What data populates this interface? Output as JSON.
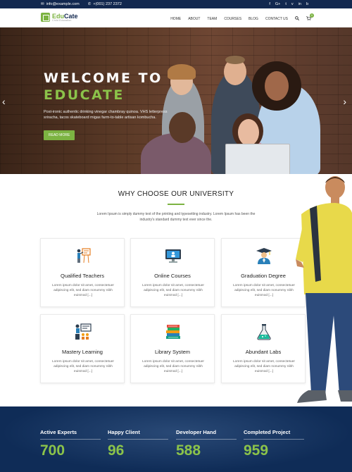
{
  "topbar": {
    "email": "info@example.com",
    "phone": "+(001) 237 2372",
    "social": [
      "f",
      "G+",
      "t",
      "v",
      "in",
      "b"
    ]
  },
  "brand": {
    "name_a": "Edu",
    "name_b": "Cate",
    "tagline": "Child Education",
    "accent": "#7cb342",
    "navy": "#12284f"
  },
  "nav": {
    "items": [
      "HOME",
      "ABOUT",
      "TEAM",
      "COURSES",
      "BLOG",
      "CONTACT US"
    ],
    "cart_count": "0"
  },
  "hero": {
    "line1": "WELCOME TO",
    "line2": "EDUCATE",
    "text": "Post-ironic authentic drinking vinegar chambray quinoa. VHS letterpress sriracha, tacos skateboard migas farm-to-table artisan kombucha.",
    "button": "READ MORE"
  },
  "why": {
    "title": "WHY CHOOSE OUR UNIVERSITY",
    "desc": "Lorem Ipsum is simply dummy text of the printing and typesetting industry. Lorem Ipsum has been the industry's standard dummy text ever since the."
  },
  "features": [
    {
      "title": "Qualified Teachers",
      "icon": "teacher-icon",
      "desc": "Lorem ipsum dolor sit amet, consectetuer adipiscing elit, sed diam nonummy nibh euismod [...]"
    },
    {
      "title": "Online Courses",
      "icon": "monitor-icon",
      "desc": "Lorem ipsum dolor sit amet, consectetuer adipiscing elit, sed diam nonummy nibh euismod [...]"
    },
    {
      "title": "Graduation Degree",
      "icon": "graduate-icon",
      "desc": "Lorem ipsum dolor sit amet, consectetuer adipiscing elit, sed diam nonummy nibh euismod [...]"
    },
    {
      "title": "Mastery Learning",
      "icon": "whiteboard-icon",
      "desc": "Lorem ipsum dolor sit amet, consectetuer adipiscing elit, sed diam nonummy nibh euismod [...]"
    },
    {
      "title": "Library System",
      "icon": "books-icon",
      "desc": "Lorem ipsum dolor sit amet, consectetuer adipiscing elit, sed diam nonummy nibh euismod [...]"
    },
    {
      "title": "Abundant Labs",
      "icon": "flask-icon",
      "desc": "Lorem ipsum dolor sit amet, consectetuer adipiscing elit, sed diam nonummy nibh euismod [...]"
    }
  ],
  "stats": [
    {
      "label": "Active Experts",
      "value": "700"
    },
    {
      "label": "Happy Client",
      "value": "96"
    },
    {
      "label": "Developer Hand",
      "value": "588"
    },
    {
      "label": "Completed Project",
      "value": "959"
    }
  ]
}
